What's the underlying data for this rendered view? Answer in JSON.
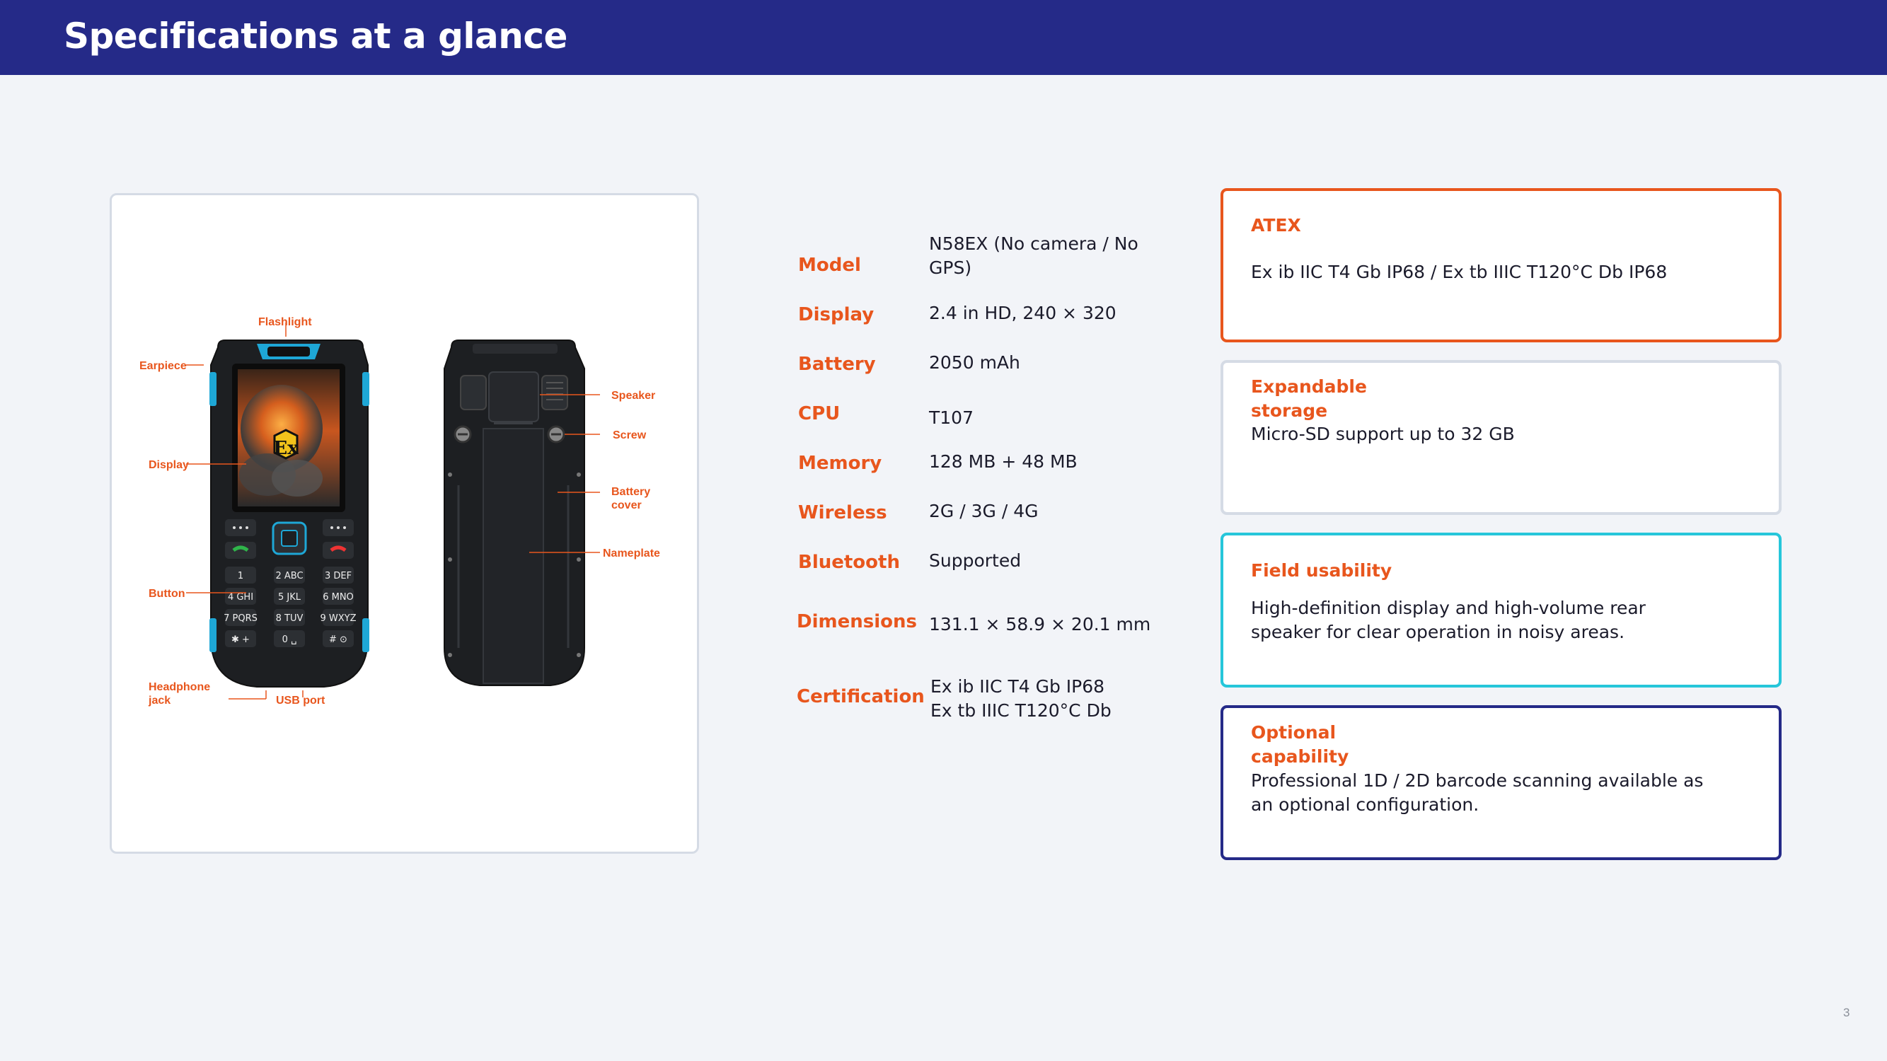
{
  "header": {
    "title": "Specifications at a glance"
  },
  "diagram": {
    "callouts": {
      "flashlight": "Flashlight",
      "earpiece": "Earpiece",
      "display": "Display",
      "button": "Button",
      "headphone_jack": "Headphone jack",
      "usb_port": "USB port",
      "speaker": "Speaker",
      "screw": "Screw",
      "battery_cover": "Battery cover",
      "nameplate": "Nameplate"
    },
    "ex_mark": "Ex",
    "keypad": [
      "1",
      "2 ABC",
      "3 DEF",
      "4 GHI",
      "5 JKL",
      "6 MNO",
      "7 PQRS",
      "8 TUV",
      "9 WXYZ",
      "✱ +",
      "0 ␣",
      "# ⊙"
    ]
  },
  "specs": [
    {
      "label": "Model",
      "value": "N58EX (No camera / No GPS)"
    },
    {
      "label": "Display",
      "value": "2.4 in HD, 240 × 320"
    },
    {
      "label": "Battery",
      "value": "2050 mAh"
    },
    {
      "label": "CPU",
      "value": "T107"
    },
    {
      "label": "Memory",
      "value": "128 MB + 48 MB"
    },
    {
      "label": "Wireless",
      "value": "2G / 3G / 4G"
    },
    {
      "label": "Bluetooth",
      "value": "Supported"
    },
    {
      "label": "Dimensions",
      "value": "131.1 × 58.9 × 20.1 mm"
    },
    {
      "label": "Certification",
      "value_line1": "Ex ib IIC T4 Gb IP68",
      "value_line2": "Ex tb IIIC T120°C Db"
    }
  ],
  "features": [
    {
      "title": "ATEX",
      "body": "Ex ib IIC T4 Gb IP68 / Ex tb IIIC T120°C Db IP68",
      "border_color": "#e8561d"
    },
    {
      "title": "Expandable storage",
      "body": "Micro-SD support up to 32 GB",
      "border_color": "#d5dbe5"
    },
    {
      "title": "Field usability",
      "body": "High-definition display and high-volume rear speaker for clear operation in noisy areas.",
      "border_color": "#26c6da"
    },
    {
      "title": "Optional capability",
      "body": "Professional 1D / 2D barcode scanning available as an optional configuration.",
      "border_color": "#252a88"
    }
  ],
  "footer": {
    "page_number": "3"
  },
  "colors": {
    "header_bg": "#252a88",
    "accent": "#e8561d",
    "page_bg": "#f2f4f8"
  }
}
